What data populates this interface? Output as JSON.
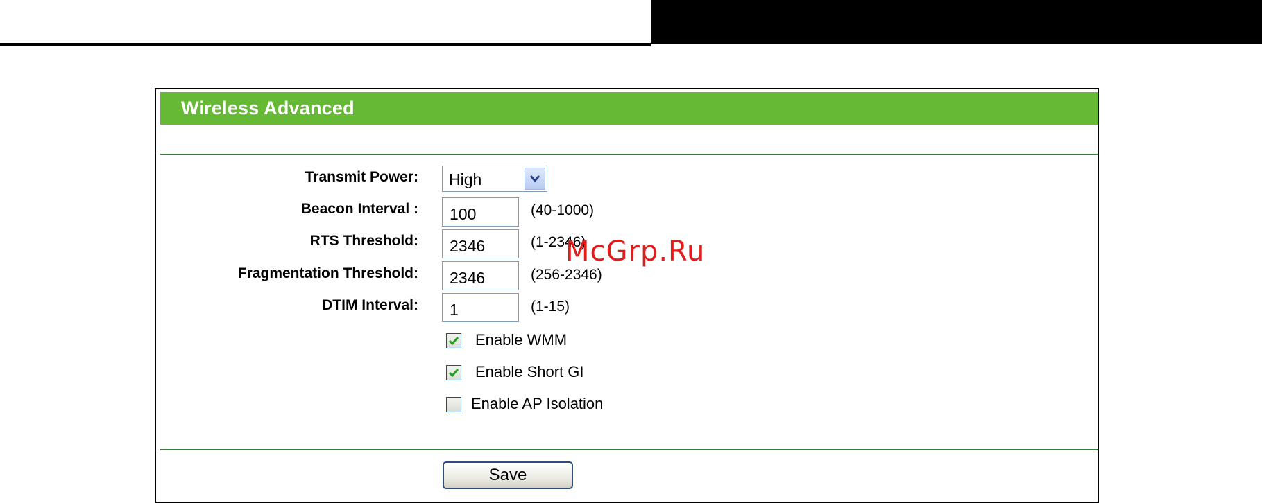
{
  "page": {
    "title": "Wireless Advanced",
    "watermark": "McGrp.Ru"
  },
  "form": {
    "transmit_power": {
      "label": "Transmit Power:",
      "value": "High"
    },
    "beacon_interval": {
      "label": "Beacon Interval :",
      "value": "100",
      "range": "(40-1000)"
    },
    "rts_threshold": {
      "label": "RTS Threshold:",
      "value": "2346",
      "range": "(1-2346)"
    },
    "fragmentation_threshold": {
      "label": "Fragmentation Threshold:",
      "value": "2346",
      "range": "(256-2346)"
    },
    "dtim_interval": {
      "label": "DTIM Interval:",
      "value": "1",
      "range": "(1-15)"
    },
    "enable_wmm": {
      "label": "Enable WMM",
      "checked": true
    },
    "enable_short_gi": {
      "label": "Enable Short GI",
      "checked": true
    },
    "enable_ap_isolation": {
      "label": "Enable AP Isolation",
      "checked": false
    },
    "save_label": "Save"
  },
  "colors": {
    "header_green": "#66b934",
    "rule_green": "#3d7a3d",
    "check_green": "#21a121",
    "watermark_red": "#e01c1c"
  },
  "icons": {
    "dropdown": "chevron-down-icon",
    "checkmark": "checkmark-icon"
  }
}
